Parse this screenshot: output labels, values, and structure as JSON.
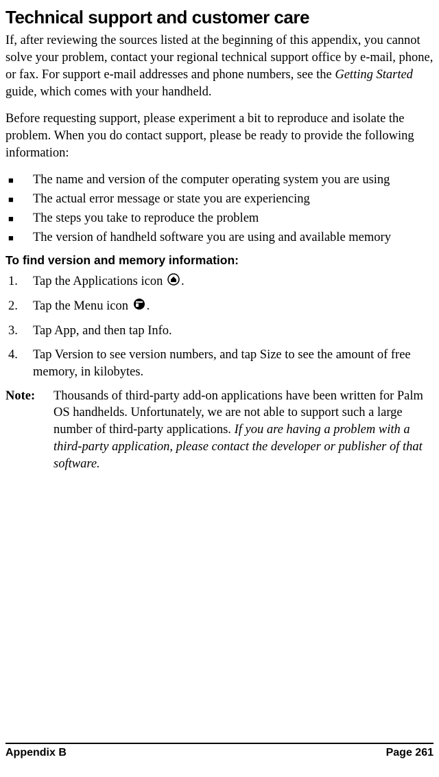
{
  "heading": "Technical support and customer care",
  "para1_pre": "If, after reviewing the sources listed at the beginning of this appendix, you cannot solve your problem, contact your regional technical support office by e-mail, phone, or fax. For support e-mail addresses and phone numbers, see the ",
  "para1_italic": "Getting Started",
  "para1_post": " guide, which comes with your handheld.",
  "para2": "Before requesting support, please experiment a bit to reproduce and isolate the problem. When you do contact support, please be ready to provide the following information:",
  "bullets": [
    "The name and version of the computer operating system you are using",
    "The actual error message or state you are experiencing",
    "The steps you take to reproduce the problem",
    "The version of handheld software you are using and available memory"
  ],
  "subheading": "To find version and memory information:",
  "step1_pre": "Tap the Applications icon ",
  "step1_post": ".",
  "step2_pre": "Tap the Menu icon ",
  "step2_post": ".",
  "step3": "Tap App, and then tap Info.",
  "step4": "Tap Version to see version numbers, and tap Size to see the amount of free memory, in kilobytes.",
  "note_label": "Note:",
  "note_pre": "Thousands of third-party add-on applications have been written for Palm OS handhelds. Unfortunately, we are not able to support such a large number of third-party applications. ",
  "note_italic": "If you are having a problem with a third-party application, please contact the developer or publisher of that software.",
  "footer_left": "Appendix B",
  "footer_right": "Page 261"
}
